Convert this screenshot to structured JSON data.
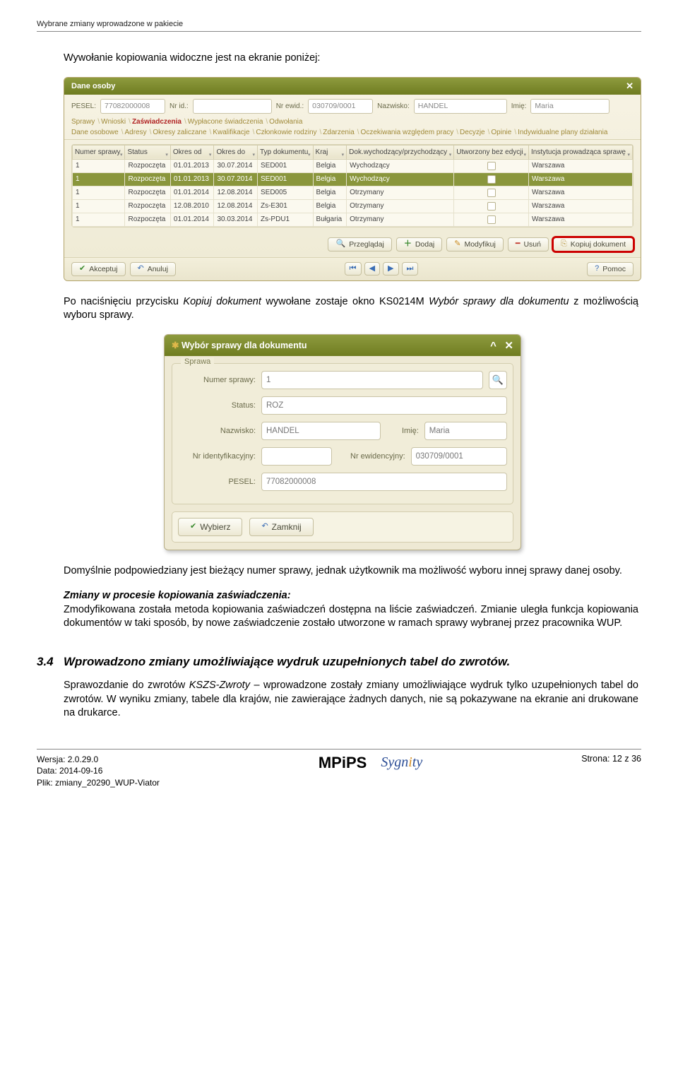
{
  "header_top": "Wybrane zmiany wprowadzone w pakiecie",
  "para1": "Wywołanie kopiowania widoczne jest na ekranie poniżej:",
  "win1": {
    "title": "Dane osoby",
    "fields": {
      "pesel_lbl": "PESEL:",
      "pesel_val": "77082000008",
      "nrid_lbl": "Nr id.:",
      "nrid_val": "",
      "nrewid_lbl": "Nr ewid.:",
      "nrewid_val": "030709/0001",
      "nazwisko_lbl": "Nazwisko:",
      "nazwisko_val": "HANDEL",
      "imie_lbl": "Imię:",
      "imie_val": "Maria"
    },
    "tabs1": [
      "Sprawy",
      "Wnioski",
      "Zaświadczenia",
      "Wypłacone świadczenia",
      "Odwołania"
    ],
    "tabs1_active_index": 2,
    "tabs2": [
      "Dane osobowe",
      "Adresy",
      "Okresy zaliczane",
      "Kwalifikacje",
      "Członkowie rodziny",
      "Zdarzenia",
      "Oczekiwania względem pracy",
      "Decyzje",
      "Opinie",
      "Indywidualne plany działania"
    ],
    "columns": [
      "Numer sprawy",
      "Status",
      "Okres od",
      "Okres do",
      "Typ dokumentu",
      "Kraj",
      "Dok.wychodzący/przychodzący",
      "Utworzony bez edycji",
      "Instytucja prowadząca sprawę"
    ],
    "rows": [
      {
        "c": [
          "1",
          "Rozpoczęta",
          "01.01.2013",
          "30.07.2014",
          "SED001",
          "Belgia",
          "Wychodzący",
          "",
          "Warszawa"
        ],
        "sel": false
      },
      {
        "c": [
          "1",
          "Rozpoczęta",
          "01.01.2013",
          "30.07.2014",
          "SED001",
          "Belgia",
          "Wychodzący",
          "",
          "Warszawa"
        ],
        "sel": true
      },
      {
        "c": [
          "1",
          "Rozpoczęta",
          "01.01.2014",
          "12.08.2014",
          "SED005",
          "Belgia",
          "Otrzymany",
          "",
          "Warszawa"
        ],
        "sel": false
      },
      {
        "c": [
          "1",
          "Rozpoczęta",
          "12.08.2010",
          "12.08.2014",
          "Zs-E301",
          "Belgia",
          "Otrzymany",
          "",
          "Warszawa"
        ],
        "sel": false
      },
      {
        "c": [
          "1",
          "Rozpoczęta",
          "01.01.2014",
          "30.03.2014",
          "Zs-PDU1",
          "Bułgaria",
          "Otrzymany",
          "",
          "Warszawa"
        ],
        "sel": false
      }
    ],
    "buttons": {
      "przegladaj": "Przeglądaj",
      "dodaj": "Dodaj",
      "modyfikuj": "Modyfikuj",
      "usun": "Usuń",
      "kopiuj": "Kopiuj dokument"
    },
    "footer": {
      "akceptuj": "Akceptuj",
      "anuluj": "Anuluj",
      "pomoc": "Pomoc"
    }
  },
  "para2_a": "Po naciśnięciu przycisku ",
  "para2_b": "Kopiuj dokument",
  "para2_c": " wywołane zostaje okno KS0214M ",
  "para2_d": "Wybór sprawy dla dokumentu",
  "para2_e": " z możliwością wyboru sprawy.",
  "dlg": {
    "title": "Wybór sprawy dla dokumentu",
    "legend": "Sprawa",
    "labels": {
      "numer": "Numer sprawy:",
      "status": "Status:",
      "nazwisko": "Nazwisko:",
      "imie": "Imię:",
      "nrident": "Nr identyfikacyjny:",
      "nrewid": "Nr ewidencyjny:",
      "pesel": "PESEL:"
    },
    "values": {
      "numer": "1",
      "status": "ROZ",
      "nazwisko": "HANDEL",
      "imie": "Maria",
      "nrident": "",
      "nrewid": "030709/0001",
      "pesel": "77082000008"
    },
    "buttons": {
      "wybierz": "Wybierz",
      "zamknij": "Zamknij"
    }
  },
  "para3": "Domyślnie podpowiedziany jest bieżący numer sprawy, jednak użytkownik ma możliwość wyboru innej sprawy danej osoby.",
  "para4_head": "Zmiany w procesie kopiowania zaświadczenia:",
  "para4_body": "Zmodyfikowana została metoda kopiowania zaświadczeń dostępna na liście zaświadczeń. Zmianie uległa funkcja kopiowania dokumentów w taki sposób, by nowe zaświadczenie zostało utworzone w ramach sprawy wybranej przez pracownika WUP.",
  "section": {
    "num": "3.4",
    "title": "Wprowadzono zmiany umożliwiające wydruk uzupełnionych tabel do zwrotów."
  },
  "para5_a": "Sprawozdanie do zwrotów ",
  "para5_b": "KSZS-Zwroty",
  "para5_c": " – wprowadzone zostały zmiany umożliwiające wydruk tylko uzupełnionych tabel do zwrotów. W wyniku zmiany, tabele dla krajów, nie zawierające żadnych danych, nie są pokazywane na ekranie ani drukowane na drukarce.",
  "footer": {
    "wersja_lbl": "Wersja: ",
    "wersja": "2.0.29.0",
    "data_lbl": "Data: ",
    "data": "2014-09-16",
    "plik_lbl": "Plik: ",
    "plik": "zmiany_20290_WUP-Viator",
    "center": "MPiPS",
    "brand": "Sygnity",
    "strona": "Strona: 12 z 36"
  }
}
